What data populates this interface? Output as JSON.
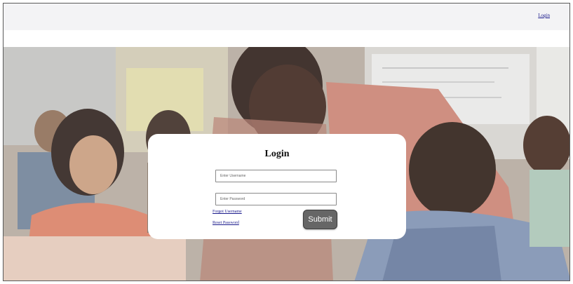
{
  "navbar": {
    "login_link": "Login"
  },
  "hero": {
    "image": "classroom-students-teacher-photo"
  },
  "login_form": {
    "title": "Login",
    "username_placeholder": "Enter Username",
    "password_placeholder": "Enter Password",
    "forgot_username": "Forgot Username",
    "reset_password": "Reset Password",
    "submit_label": "Submit"
  },
  "colors": {
    "navbar_bg": "#f3f3f5",
    "card_bg": "#ffffff",
    "button_bg": "#666666",
    "link": "#1a1a8c"
  }
}
